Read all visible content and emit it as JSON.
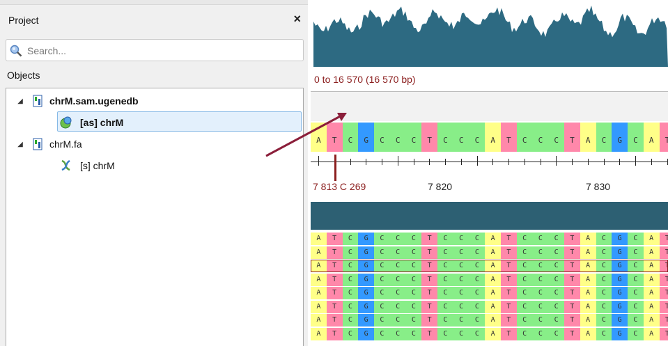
{
  "panel": {
    "title": "Project",
    "close_glyph": "×",
    "search_placeholder": "Search...",
    "objects_label": "Objects"
  },
  "tree": [
    {
      "label": "chrM.sam.ugenedb",
      "bold": true,
      "icon": "database-icon"
    },
    {
      "label": "[as] chrM",
      "bold": true,
      "icon": "assembly-icon",
      "selected": true
    },
    {
      "label": "chrM.fa",
      "bold": false,
      "icon": "database-icon"
    },
    {
      "label": "[s] chrM",
      "bold": false,
      "icon": "sequence-icon"
    }
  ],
  "view": {
    "range_text": "0 to 16 570 (16 570 bp)",
    "sequence": "ATCGCCCTCCCATCCCTACGCAT",
    "ruler": {
      "current_label": "7 813 C 269",
      "labels": [
        "7 820",
        "7 830"
      ]
    },
    "read_rows": 8,
    "nucleotide_colors": {
      "A": "#ffff88",
      "T": "#ff88aa",
      "C": "#88ee88",
      "G": "#3399ff"
    }
  }
}
